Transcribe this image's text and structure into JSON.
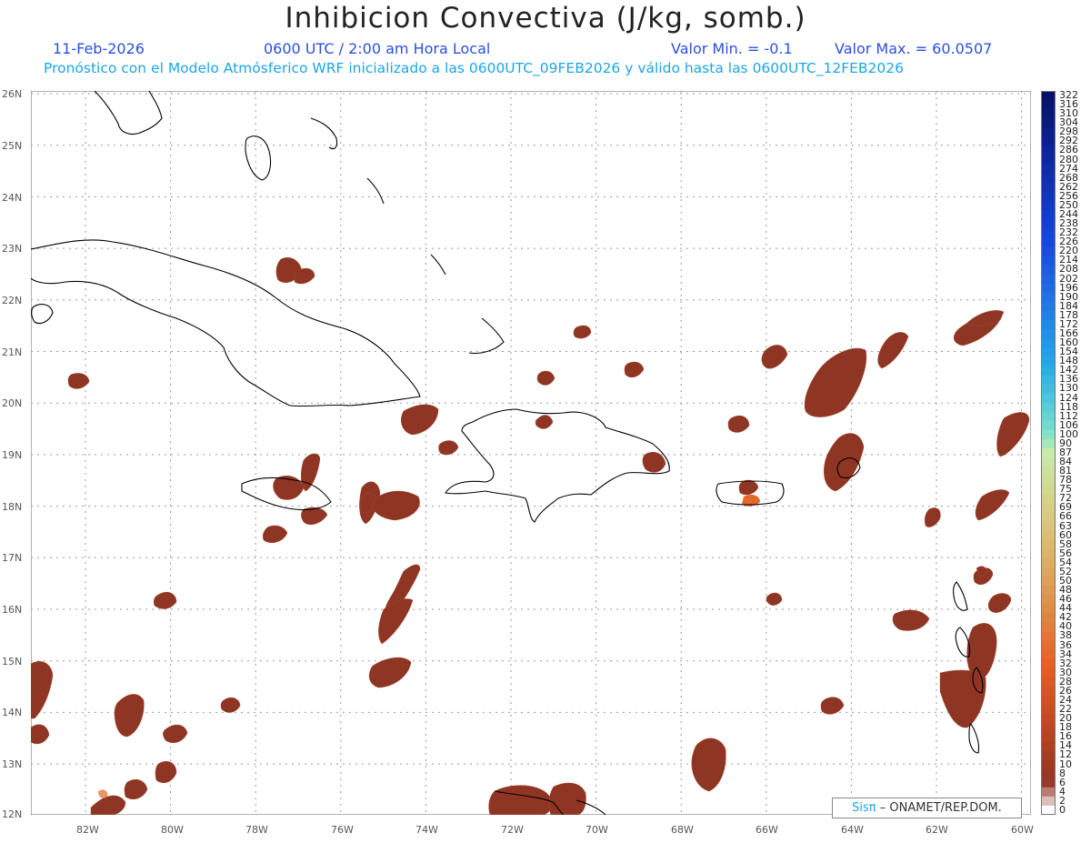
{
  "title": "Inhibicion Convectiva (J/kg, somb.)",
  "header": {
    "date": "11-Feb-2026",
    "time": "0600 UTC / 2:00 am Hora Local",
    "min_label": "Valor Min. = -0.1",
    "max_label": "Valor Max. = 60.0507",
    "forecast": "Pronóstico con el Modelo Atmósferico WRF inicializado a las 0600UTC_09FEB2026 y válido hasta las  0600UTC_12FEB2026"
  },
  "axes": {
    "lat_labels": [
      "26N",
      "25N",
      "24N",
      "23N",
      "22N",
      "21N",
      "20N",
      "19N",
      "18N",
      "17N",
      "16N",
      "15N",
      "14N",
      "13N",
      "12N"
    ],
    "lon_labels": [
      "82W",
      "80W",
      "78W",
      "76W",
      "74W",
      "72W",
      "70W",
      "68W",
      "66W",
      "64W",
      "62W",
      "60W"
    ]
  },
  "colorbar": {
    "labels": [
      "322",
      "316",
      "310",
      "304",
      "298",
      "292",
      "286",
      "280",
      "274",
      "268",
      "262",
      "256",
      "250",
      "244",
      "238",
      "232",
      "226",
      "220",
      "214",
      "208",
      "202",
      "196",
      "190",
      "184",
      "178",
      "172",
      "166",
      "160",
      "154",
      "148",
      "142",
      "136",
      "130",
      "124",
      "118",
      "112",
      "106",
      "100",
      "90",
      "87",
      "84",
      "81",
      "78",
      "75",
      "72",
      "69",
      "66",
      "63",
      "60",
      "58",
      "56",
      "54",
      "52",
      "50",
      "48",
      "46",
      "44",
      "42",
      "40",
      "38",
      "36",
      "34",
      "32",
      "30",
      "28",
      "26",
      "24",
      "22",
      "20",
      "18",
      "16",
      "14",
      "12",
      "10",
      "8",
      "6",
      "4",
      "2",
      "0"
    ]
  },
  "credit": {
    "sis": "Sisπ",
    "org": "– ONAMET/REP.DOM."
  },
  "colors": {
    "cin_fill": "#8f3524",
    "cin_high": "#e06a2a",
    "coast": "#000000",
    "grid": "#9a9a9a"
  }
}
